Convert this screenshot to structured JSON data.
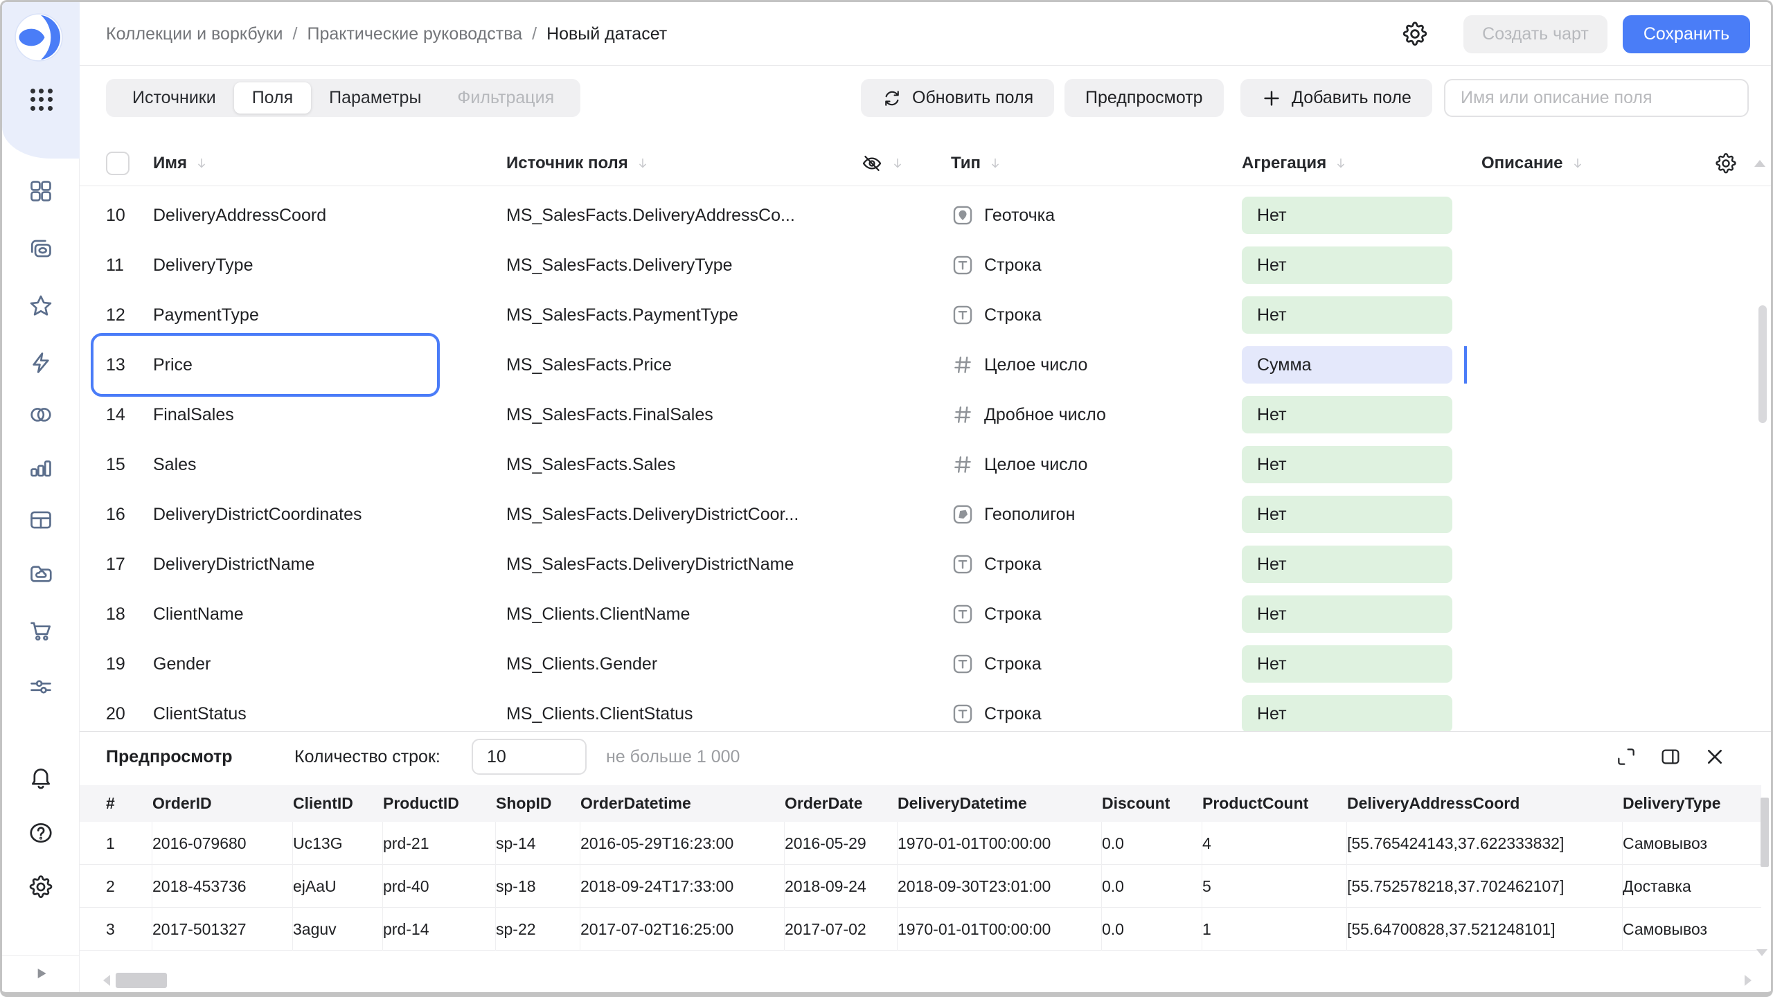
{
  "colors": {
    "accent_blue": "#4a7df7",
    "selection_outline": "#4a7cf8",
    "badge_green": "#dff2e0",
    "badge_blue": "#e4e8fb",
    "sidebar_top_bg": "#e9eefb",
    "button_gray_bg": "#f0f0f2"
  },
  "sidebar": {
    "nav_icons": [
      "grid-tiles",
      "collections",
      "favorites-star",
      "lightning",
      "linked-circles",
      "bar-chart",
      "table",
      "cloud-folder",
      "cart",
      "filters-sliders"
    ],
    "footer_icons": [
      "bell",
      "help",
      "gear"
    ]
  },
  "topbar": {
    "breadcrumbs": [
      "Коллекции и воркбуки",
      "Практические руководства",
      "Новый датасет"
    ],
    "create_chart_label": "Создать чарт",
    "save_label": "Сохранить"
  },
  "toolbar": {
    "tabs": [
      {
        "label": "Источники",
        "state": "normal"
      },
      {
        "label": "Поля",
        "state": "active"
      },
      {
        "label": "Параметры",
        "state": "normal"
      },
      {
        "label": "Фильтрация",
        "state": "disabled"
      }
    ],
    "refresh_label": "Обновить поля",
    "preview_label": "Предпросмотр",
    "add_field_label": "Добавить поле",
    "search_placeholder": "Имя или описание поля"
  },
  "fields_table": {
    "columns": {
      "name": "Имя",
      "source": "Источник поля",
      "type": "Тип",
      "aggregation": "Агрегация",
      "description": "Описание"
    },
    "rows": [
      {
        "num": "10",
        "name": "DeliveryAddressCoord",
        "source": "MS_SalesFacts.DeliveryAddressCo...",
        "type_icon": "geopoint",
        "type_label": "Геоточка",
        "aggregation": "Нет",
        "selected": false
      },
      {
        "num": "11",
        "name": "DeliveryType",
        "source": "MS_SalesFacts.DeliveryType",
        "type_icon": "string",
        "type_label": "Строка",
        "aggregation": "Нет",
        "selected": false
      },
      {
        "num": "12",
        "name": "PaymentType",
        "source": "MS_SalesFacts.PaymentType",
        "type_icon": "string",
        "type_label": "Строка",
        "aggregation": "Нет",
        "selected": false
      },
      {
        "num": "13",
        "name": "Price",
        "source": "MS_SalesFacts.Price",
        "type_icon": "number",
        "type_label": "Целое число",
        "aggregation": "Сумма",
        "selected": true
      },
      {
        "num": "14",
        "name": "FinalSales",
        "source": "MS_SalesFacts.FinalSales",
        "type_icon": "number",
        "type_label": "Дробное число",
        "aggregation": "Нет",
        "selected": false
      },
      {
        "num": "15",
        "name": "Sales",
        "source": "MS_SalesFacts.Sales",
        "type_icon": "number",
        "type_label": "Целое число",
        "aggregation": "Нет",
        "selected": false
      },
      {
        "num": "16",
        "name": "DeliveryDistrictCoordinates",
        "source": "MS_SalesFacts.DeliveryDistrictCoor...",
        "type_icon": "geopolygon",
        "type_label": "Геополигон",
        "aggregation": "Нет",
        "selected": false
      },
      {
        "num": "17",
        "name": "DeliveryDistrictName",
        "source": "MS_SalesFacts.DeliveryDistrictName",
        "type_icon": "string",
        "type_label": "Строка",
        "aggregation": "Нет",
        "selected": false
      },
      {
        "num": "18",
        "name": "ClientName",
        "source": "MS_Clients.ClientName",
        "type_icon": "string",
        "type_label": "Строка",
        "aggregation": "Нет",
        "selected": false
      },
      {
        "num": "19",
        "name": "Gender",
        "source": "MS_Clients.Gender",
        "type_icon": "string",
        "type_label": "Строка",
        "aggregation": "Нет",
        "selected": false
      },
      {
        "num": "20",
        "name": "ClientStatus",
        "source": "MS_Clients.ClientStatus",
        "type_icon": "string",
        "type_label": "Строка",
        "aggregation": "Нет",
        "selected": false
      }
    ]
  },
  "preview": {
    "title": "Предпросмотр",
    "rows_count_label": "Количество строк:",
    "rows_count_value": "10",
    "rows_count_hint": "не больше 1 000",
    "table": {
      "columns": [
        "#",
        "OrderID",
        "ClientID",
        "ProductID",
        "ShopID",
        "OrderDatetime",
        "OrderDate",
        "DeliveryDatetime",
        "Discount",
        "ProductCount",
        "DeliveryAddressCoord",
        "DeliveryType"
      ],
      "rows": [
        [
          "1",
          "2016-079680",
          "Uc13G",
          "prd-21",
          "sp-14",
          "2016-05-29T16:23:00",
          "2016-05-29",
          "1970-01-01T00:00:00",
          "0.0",
          "4",
          "[55.765424143,37.622333832]",
          "Самовывоз"
        ],
        [
          "2",
          "2018-453736",
          "ejAaU",
          "prd-40",
          "sp-18",
          "2018-09-24T17:33:00",
          "2018-09-24",
          "2018-09-30T23:01:00",
          "0.0",
          "5",
          "[55.752578218,37.702462107]",
          "Доставка"
        ],
        [
          "3",
          "2017-501327",
          "3aguv",
          "prd-14",
          "sp-22",
          "2017-07-02T16:25:00",
          "2017-07-02",
          "1970-01-01T00:00:00",
          "0.0",
          "1",
          "[55.64700828,37.521248101]",
          "Самовывоз"
        ]
      ]
    }
  }
}
